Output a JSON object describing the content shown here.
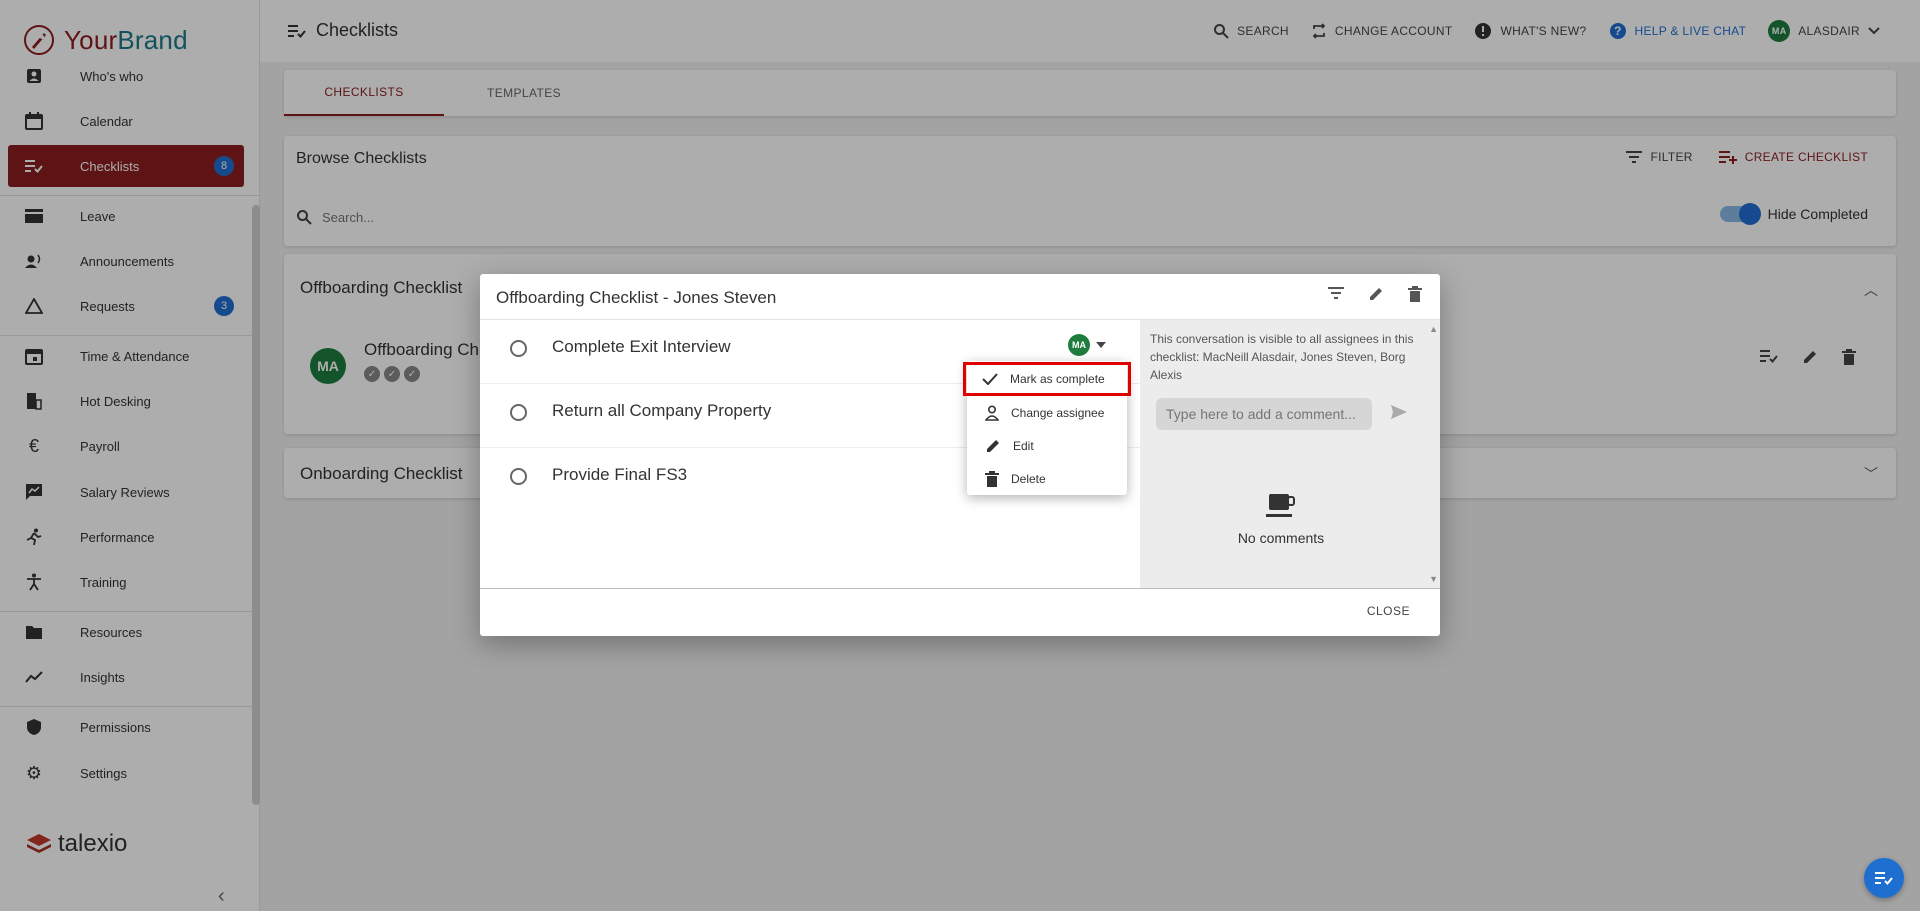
{
  "brand": {
    "your": "Your",
    "name": "Brand"
  },
  "sidebar": {
    "items": [
      {
        "label": "Who's who",
        "icon": "contacts-icon"
      },
      {
        "label": "Calendar",
        "icon": "calendar-icon"
      },
      {
        "label": "Checklists",
        "icon": "checklist-icon",
        "badge": "8",
        "active": true
      },
      {
        "label": "Leave",
        "icon": "leave-icon"
      },
      {
        "label": "Announcements",
        "icon": "megaphone-icon"
      },
      {
        "label": "Requests",
        "icon": "warning-triangle-icon",
        "badge": "3"
      },
      {
        "label": "Time & Attendance",
        "icon": "calendar-check-icon"
      },
      {
        "label": "Hot Desking",
        "icon": "building-icon"
      },
      {
        "label": "Payroll",
        "icon": "euro-icon"
      },
      {
        "label": "Salary Reviews",
        "icon": "chart-message-icon"
      },
      {
        "label": "Performance",
        "icon": "running-icon"
      },
      {
        "label": "Training",
        "icon": "accessibility-icon"
      },
      {
        "label": "Resources",
        "icon": "folder-icon"
      },
      {
        "label": "Insights",
        "icon": "trend-icon"
      },
      {
        "label": "Permissions",
        "icon": "shield-icon"
      },
      {
        "label": "Settings",
        "icon": "gear-icon"
      }
    ],
    "footer_logo": "talexio",
    "collapse_icon": "chevron-left-icon"
  },
  "topbar": {
    "title": "Checklists",
    "search": "SEARCH",
    "change_account": "CHANGE ACCOUNT",
    "whats_new": "WHAT'S NEW?",
    "help": "HELP & LIVE CHAT",
    "user": "ALASDAIR",
    "user_initials": "MA"
  },
  "tabs": [
    "CHECKLISTS",
    "TEMPLATES"
  ],
  "browse": {
    "title": "Browse Checklists",
    "filter": "FILTER",
    "create": "CREATE CHECKLIST",
    "search_placeholder": "Search...",
    "hide_completed": "Hide Completed"
  },
  "groups": {
    "offboarding": "Offboarding Checklist",
    "offboarding_row": "Offboarding Ch",
    "onboarding": "Onboarding Checklist",
    "row_initials": "MA"
  },
  "dialog": {
    "title": "Offboarding Checklist - Jones Steven",
    "items": [
      "Complete Exit Interview",
      "Return all Company Property",
      "Provide Final FS3"
    ],
    "assignee_initials": "MA",
    "comments_note": "This conversation is visible to all assignees in this checklist: MacNeill Alasdair, Jones Steven, Borg Alexis",
    "comment_placeholder": "Type here to add a comment...",
    "no_comments": "No comments",
    "close": "CLOSE"
  },
  "menu": {
    "items": [
      "Mark as complete",
      "Change assignee",
      "Edit",
      "Delete"
    ]
  },
  "colors": {
    "brand_red": "#8b1e1e",
    "accent_blue": "#1f6fd1",
    "avatar_green": "#1e7c3e",
    "highlight_red": "#e00000"
  }
}
